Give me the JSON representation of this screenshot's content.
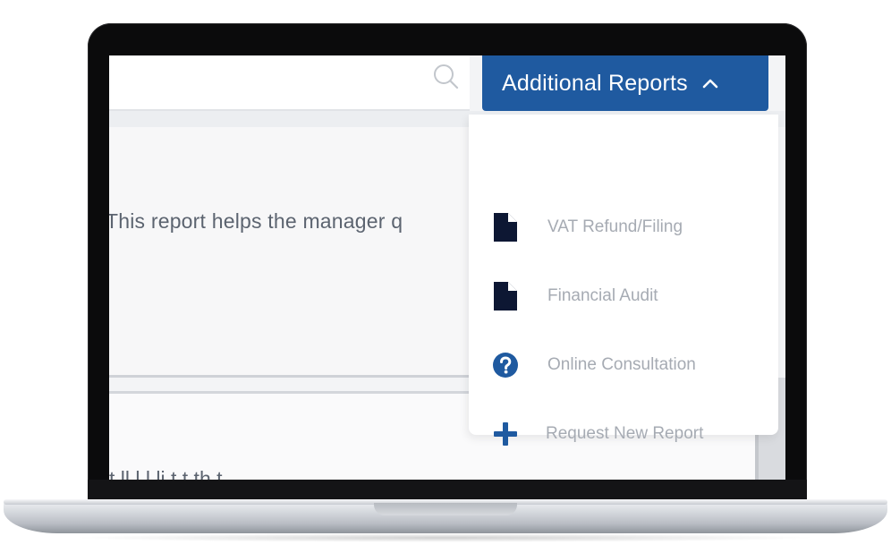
{
  "search": {
    "icon": "search-icon"
  },
  "content": {
    "card_1_text": "This report helps the manager q",
    "card_2_text": "t        ll      l           l   li  t           t   th        t"
  },
  "dropdown": {
    "label": "Additional Reports",
    "icon": "chevron-up-icon",
    "color": "#1f5aa0",
    "items": [
      {
        "label": "VAT Refund/Filing",
        "icon": "file-icon"
      },
      {
        "label": "Financial Audit",
        "icon": "file-icon"
      },
      {
        "label": "Online Consultation",
        "icon": "question-circle-icon"
      },
      {
        "label": "Request New Report",
        "icon": "plus-icon"
      }
    ]
  },
  "colors": {
    "icon_navy": "#0d1733",
    "icon_blue": "#1f5aa0",
    "menu_text": "#a6abb3"
  }
}
